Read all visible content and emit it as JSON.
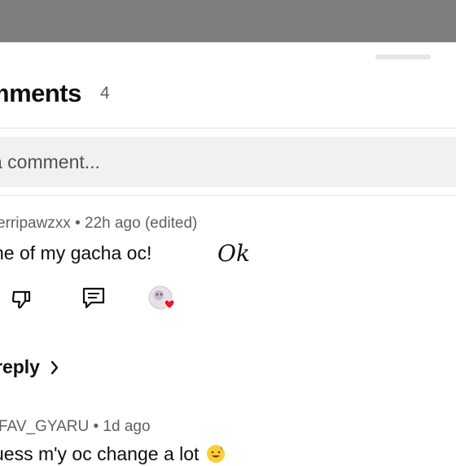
{
  "sheet": {
    "title": "mments",
    "count": "4"
  },
  "add_comment": {
    "placeholder": "a comment..."
  },
  "comments": [
    {
      "author_meta": "erripawzxx • 22h ago (edited)",
      "text": "ne of my gacha oc!",
      "handwritten_note": "Ok",
      "reply_label": "reply"
    },
    {
      "author_meta": "FAV_GYARU • 1d ago",
      "text": "uess m'y oc change a lot"
    }
  ],
  "icons": {
    "dislike": "thumbs-down-icon",
    "reply": "comment-reply-icon",
    "creator_heart": "creator-heart-avatar-icon",
    "chevron": "chevron-right-icon"
  },
  "colors": {
    "top_overlay": "#7f7f7f",
    "heart": "#e8172b"
  }
}
